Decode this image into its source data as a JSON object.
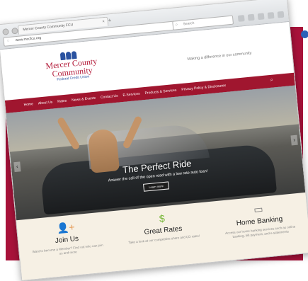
{
  "browser": {
    "tab_title": "Mercer County Community FCU",
    "url": "www.mccfcu.org",
    "search_placeholder": "Search"
  },
  "site": {
    "logo": {
      "line1": "Mercer County",
      "line2": "Community",
      "line3": "Federal Credit Union"
    },
    "tagline": "Making a difference in our community",
    "nav": [
      "Home",
      "About Us",
      "Rates",
      "News & Events",
      "Contact Us",
      "E-Services",
      "Products & Services",
      "Privacy Policy & Disclosures"
    ],
    "hero": {
      "title": "The Perfect Ride",
      "subtitle": "Answer the call of the open road with a low rate auto loan!",
      "button": "Learn more"
    },
    "features": [
      {
        "icon": "add-user-icon",
        "title": "Join Us",
        "desc": "Want to become a Member? Find out who can join us and more"
      },
      {
        "icon": "dollar-icon",
        "title": "Great Rates",
        "desc": "Take a look at our competitive share and CD rates!"
      },
      {
        "icon": "computer-icon",
        "title": "Home Banking",
        "desc": "Access our home banking services such as online banking, bill payment, and e-statements"
      }
    ]
  },
  "colors": {
    "brand_red": "#a0162f",
    "brand_blue": "#2a52a0",
    "backdrop": "#a8123a"
  }
}
